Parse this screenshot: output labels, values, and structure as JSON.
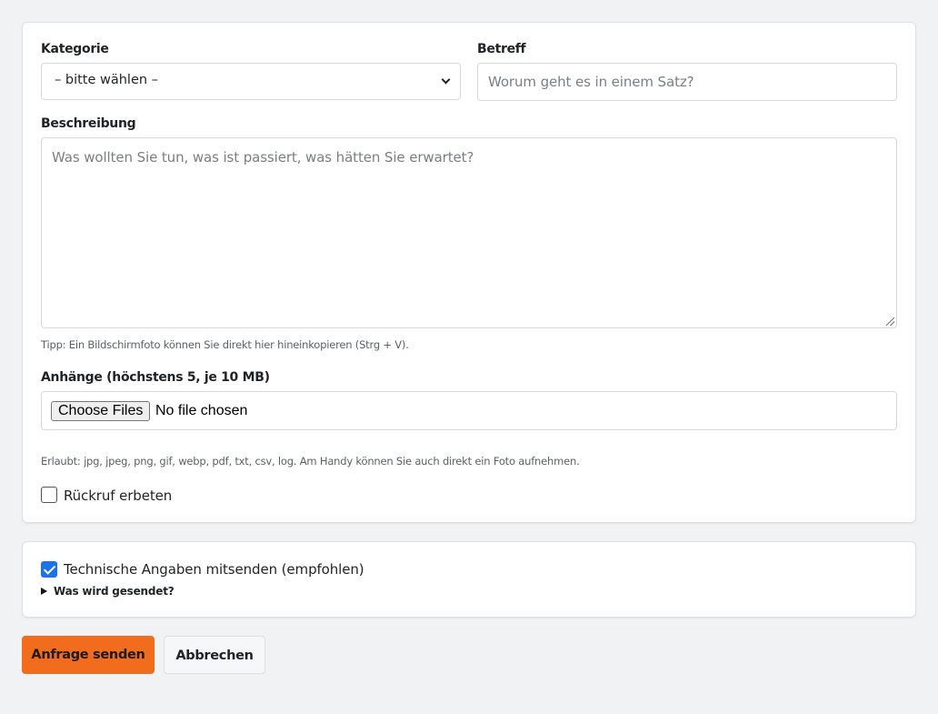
{
  "form": {
    "category": {
      "label": "Kategorie",
      "selected": "– bitte wählen –"
    },
    "subject": {
      "label": "Betreff",
      "placeholder": "Worum geht es in einem Satz?"
    },
    "description": {
      "label": "Beschreibung",
      "placeholder": "Was wollten Sie tun, was ist passiert, was hätten Sie erwartet?",
      "hint": "Tipp: Ein Bildschirmfoto können Sie direkt hier hineinkopieren (Strg + V)."
    },
    "attachments": {
      "label": "Anhänge (höchstens 5, je 10 MB)",
      "button_label": "Choose Files",
      "status": "No file chosen",
      "hint": "Erlaubt: jpg, jpeg, png, gif, webp, pdf, txt, csv, log. Am Handy können Sie auch direkt ein Foto aufnehmen."
    },
    "callback": {
      "label": "Rückruf erbeten",
      "checked": false
    }
  },
  "technical": {
    "label": "Technische Angaben mitsenden (empfohlen)",
    "checked": true,
    "details_summary": "Was wird gesendet?"
  },
  "actions": {
    "submit_label": "Anfrage senden",
    "cancel_label": "Abbrechen"
  },
  "colors": {
    "accent": "#f26c1d",
    "checkbox_checked": "#1a73e8",
    "background": "#f1f2f4"
  }
}
